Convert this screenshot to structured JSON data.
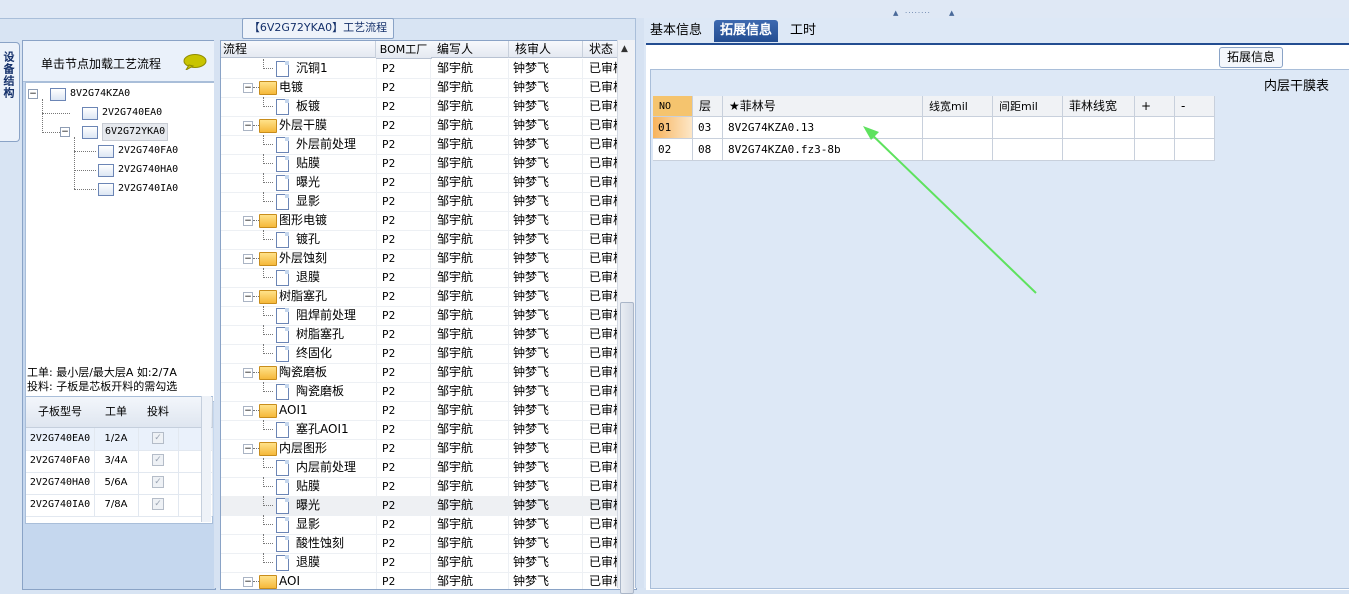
{
  "window": {
    "process_title": "【6V2G72YKA0】工艺流程",
    "device_tab": "设备结构"
  },
  "left": {
    "load_hint": "单击节点加载工艺流程",
    "tree": [
      {
        "label": "8V2G74KZA0",
        "level": 0
      },
      {
        "label": "2V2G740EA0",
        "level": 1
      },
      {
        "label": "6V2G72YKA0",
        "level": 1
      },
      {
        "label": "2V2G740FA0",
        "level": 2
      },
      {
        "label": "2V2G740HA0",
        "level": 2
      },
      {
        "label": "2V2G740IA0",
        "level": 2
      }
    ],
    "note_line1": "工单: 最小层/最大层A 如:2/7A",
    "note_line2": "投料: 子板是芯板开料的需勾选",
    "board_table": {
      "headers": [
        "子板型号",
        "工单",
        "投料"
      ],
      "rows": [
        {
          "model": "2V2G740EA0",
          "order": "1/2A",
          "feed": true
        },
        {
          "model": "2V2G740FA0",
          "order": "3/4A",
          "feed": true
        },
        {
          "model": "2V2G740HA0",
          "order": "5/6A",
          "feed": true
        },
        {
          "model": "2V2G740IA0",
          "order": "7/8A",
          "feed": true
        }
      ]
    }
  },
  "process": {
    "headers": [
      "流程",
      "BOM工厂",
      "编写人",
      "核审人",
      "状态"
    ],
    "rows": [
      {
        "name": "沉铜1",
        "type": "doc",
        "level": 2,
        "factory": "P2",
        "writer": "邹宇航",
        "reviewer": "钟梦飞",
        "status": "已审核"
      },
      {
        "name": "电镀",
        "type": "folder",
        "level": 1,
        "factory": "P2",
        "writer": "邹宇航",
        "reviewer": "钟梦飞",
        "status": "已审核"
      },
      {
        "name": "板镀",
        "type": "doc",
        "level": 2,
        "factory": "P2",
        "writer": "邹宇航",
        "reviewer": "钟梦飞",
        "status": "已审核"
      },
      {
        "name": "外层干膜",
        "type": "folder",
        "level": 1,
        "factory": "P2",
        "writer": "邹宇航",
        "reviewer": "钟梦飞",
        "status": "已审核"
      },
      {
        "name": "外层前处理",
        "type": "doc",
        "level": 2,
        "factory": "P2",
        "writer": "邹宇航",
        "reviewer": "钟梦飞",
        "status": "已审核"
      },
      {
        "name": "贴膜",
        "type": "doc",
        "level": 2,
        "factory": "P2",
        "writer": "邹宇航",
        "reviewer": "钟梦飞",
        "status": "已审核"
      },
      {
        "name": "曝光",
        "type": "doc",
        "level": 2,
        "factory": "P2",
        "writer": "邹宇航",
        "reviewer": "钟梦飞",
        "status": "已审核"
      },
      {
        "name": "显影",
        "type": "doc",
        "level": 2,
        "factory": "P2",
        "writer": "邹宇航",
        "reviewer": "钟梦飞",
        "status": "已审核"
      },
      {
        "name": "图形电镀",
        "type": "folder",
        "level": 1,
        "factory": "P2",
        "writer": "邹宇航",
        "reviewer": "钟梦飞",
        "status": "已审核"
      },
      {
        "name": "镀孔",
        "type": "doc",
        "level": 2,
        "factory": "P2",
        "writer": "邹宇航",
        "reviewer": "钟梦飞",
        "status": "已审核"
      },
      {
        "name": "外层蚀刻",
        "type": "folder",
        "level": 1,
        "factory": "P2",
        "writer": "邹宇航",
        "reviewer": "钟梦飞",
        "status": "已审核"
      },
      {
        "name": "退膜",
        "type": "doc",
        "level": 2,
        "factory": "P2",
        "writer": "邹宇航",
        "reviewer": "钟梦飞",
        "status": "已审核"
      },
      {
        "name": "树脂塞孔",
        "type": "folder",
        "level": 1,
        "factory": "P2",
        "writer": "邹宇航",
        "reviewer": "钟梦飞",
        "status": "已审核"
      },
      {
        "name": "阻焊前处理",
        "type": "doc",
        "level": 2,
        "factory": "P2",
        "writer": "邹宇航",
        "reviewer": "钟梦飞",
        "status": "已审核"
      },
      {
        "name": "树脂塞孔",
        "type": "doc",
        "level": 2,
        "factory": "P2",
        "writer": "邹宇航",
        "reviewer": "钟梦飞",
        "status": "已审核"
      },
      {
        "name": "终固化",
        "type": "doc",
        "level": 2,
        "factory": "P2",
        "writer": "邹宇航",
        "reviewer": "钟梦飞",
        "status": "已审核"
      },
      {
        "name": "陶瓷磨板",
        "type": "folder",
        "level": 1,
        "factory": "P2",
        "writer": "邹宇航",
        "reviewer": "钟梦飞",
        "status": "已审核"
      },
      {
        "name": "陶瓷磨板",
        "type": "doc",
        "level": 2,
        "factory": "P2",
        "writer": "邹宇航",
        "reviewer": "钟梦飞",
        "status": "已审核"
      },
      {
        "name": "AOI1",
        "type": "folder",
        "level": 1,
        "factory": "P2",
        "writer": "邹宇航",
        "reviewer": "钟梦飞",
        "status": "已审核"
      },
      {
        "name": "塞孔AOI1",
        "type": "doc",
        "level": 2,
        "factory": "P2",
        "writer": "邹宇航",
        "reviewer": "钟梦飞",
        "status": "已审核"
      },
      {
        "name": "内层图形",
        "type": "folder",
        "level": 1,
        "factory": "P2",
        "writer": "邹宇航",
        "reviewer": "钟梦飞",
        "status": "已审核"
      },
      {
        "name": "内层前处理",
        "type": "doc",
        "level": 2,
        "factory": "P2",
        "writer": "邹宇航",
        "reviewer": "钟梦飞",
        "status": "已审核"
      },
      {
        "name": "贴膜",
        "type": "doc",
        "level": 2,
        "factory": "P2",
        "writer": "邹宇航",
        "reviewer": "钟梦飞",
        "status": "已审核"
      },
      {
        "name": "曝光",
        "type": "doc",
        "level": 2,
        "factory": "P2",
        "writer": "邹宇航",
        "reviewer": "钟梦飞",
        "status": "已审核",
        "selected": true
      },
      {
        "name": "显影",
        "type": "doc",
        "level": 2,
        "factory": "P2",
        "writer": "邹宇航",
        "reviewer": "钟梦飞",
        "status": "已审核"
      },
      {
        "name": "酸性蚀刻",
        "type": "doc",
        "level": 2,
        "factory": "P2",
        "writer": "邹宇航",
        "reviewer": "钟梦飞",
        "status": "已审核"
      },
      {
        "name": "退膜",
        "type": "doc",
        "level": 2,
        "factory": "P2",
        "writer": "邹宇航",
        "reviewer": "钟梦飞",
        "status": "已审核"
      },
      {
        "name": "AOI",
        "type": "folder",
        "level": 1,
        "factory": "P2",
        "writer": "邹宇航",
        "reviewer": "钟梦飞",
        "status": "已审核"
      }
    ]
  },
  "right": {
    "tabs": [
      "基本信息",
      "拓展信息",
      "工时"
    ],
    "active_tab": "拓展信息",
    "subtab": "拓展信息",
    "inner_title": "内层干膜表",
    "table": {
      "headers": [
        "NO",
        "层",
        "★菲林号",
        "线宽mil",
        "间距mil",
        "菲林线宽",
        "+",
        "-"
      ],
      "rows": [
        {
          "no": "01",
          "layer": "03",
          "film": "8V2G74KZA0.13",
          "selected": true
        },
        {
          "no": "02",
          "layer": "08",
          "film": "8V2G74KZA0.fz3-8b"
        }
      ]
    }
  },
  "colors": {
    "accent": "#234d91",
    "annotation_arrow": "#5ee25e",
    "selected_cell": "#f7b35c"
  },
  "icons": [
    "speech-bubble-icon",
    "folder-icon",
    "document-icon",
    "checkbox-icon",
    "scroll-up-arrow-icon"
  ]
}
